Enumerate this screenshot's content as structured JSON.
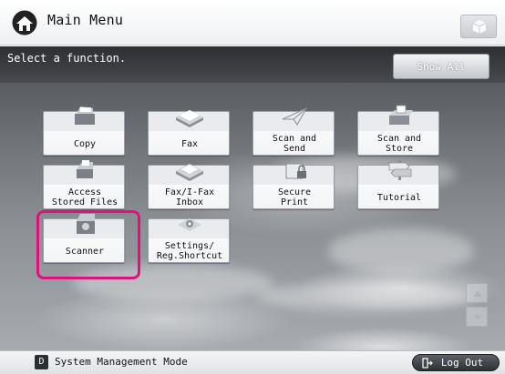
{
  "header": {
    "title": "Main Menu"
  },
  "instruction": "Select a function.",
  "show_all_label": "Show All",
  "functions": [
    {
      "label": "Copy"
    },
    {
      "label": "Fax"
    },
    {
      "label": "Scan and\nSend",
      "line1": "Scan and",
      "line2": "Send"
    },
    {
      "label": "Scan and\nStore",
      "line1": "Scan and",
      "line2": "Store"
    },
    {
      "label": "Access\nStored Files",
      "line1": "Access",
      "line2": "Stored Files"
    },
    {
      "label": "Fax/I-Fax\nInbox",
      "line1": "Fax/I-Fax",
      "line2": "Inbox"
    },
    {
      "label": "Secure\nPrint",
      "line1": "Secure",
      "line2": "Print"
    },
    {
      "label": "Tutorial"
    },
    {
      "label": "Scanner"
    },
    {
      "label": "Settings/\nReg.Shortcut",
      "line1": "Settings/",
      "line2": "Reg.Shortcut"
    }
  ],
  "selected_function": "Scanner",
  "footer": {
    "system_icon": "D",
    "system_label": "System Management Mode",
    "logout_label": "Log Out"
  },
  "colors": {
    "highlight": "#d8157a",
    "accent": "#2b2e33"
  }
}
